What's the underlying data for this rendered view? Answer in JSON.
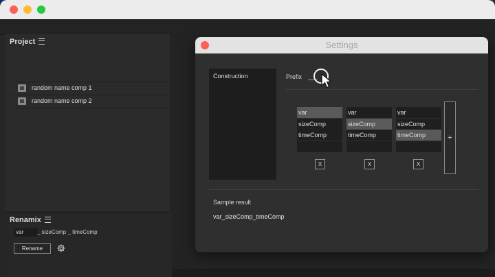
{
  "project_panel": {
    "title": "Project",
    "items": [
      {
        "label": "random name comp 1"
      },
      {
        "label": "random name comp 2"
      }
    ]
  },
  "renamix_panel": {
    "title": "Renamix",
    "field_var": "var",
    "field_rest": "_ sizeComp _ timeComp",
    "rename_label": "Rename"
  },
  "settings_dialog": {
    "title": "Settings",
    "construction_label": "Construction",
    "prefix_label": "Prefix",
    "columns": [
      {
        "items": [
          "var",
          "sizeComp",
          "timeComp",
          ""
        ],
        "selected": 0
      },
      {
        "items": [
          "var",
          "sizeComp",
          "timeComp",
          ""
        ],
        "selected": 1
      },
      {
        "items": [
          "var",
          "sizeComp",
          "timeComp",
          ""
        ],
        "selected": 2
      }
    ],
    "remove_label": "X",
    "add_label": "+",
    "sample_label": "Sample result",
    "sample_value": "var_sizeComp_timeComp"
  },
  "icons": {
    "window_controls": [
      "close-dot",
      "minimize-dot",
      "zoom-dot"
    ],
    "panel_menu": "hamburger-icon",
    "comp_icon": "composition-icon",
    "settings": "gear-icon",
    "cursor": "arrow-cursor-icon"
  },
  "colors": {
    "close": "#fe5f57",
    "minimize": "#febc2e",
    "zoom": "#28c840",
    "selected_item": "#5a5a5a"
  }
}
